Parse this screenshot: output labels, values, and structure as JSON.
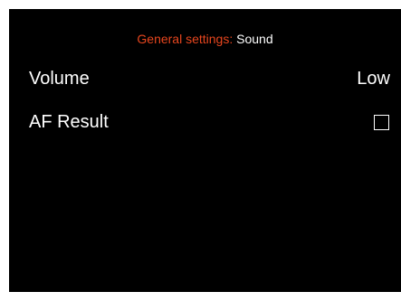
{
  "header": {
    "section": "General settings:",
    "page": "Sound"
  },
  "settings": [
    {
      "label": "Volume",
      "value": "Low"
    },
    {
      "label": "AF Result",
      "checked": false
    }
  ],
  "colors": {
    "background": "#000000",
    "accent": "#e8461e",
    "text": "#ffffff"
  }
}
